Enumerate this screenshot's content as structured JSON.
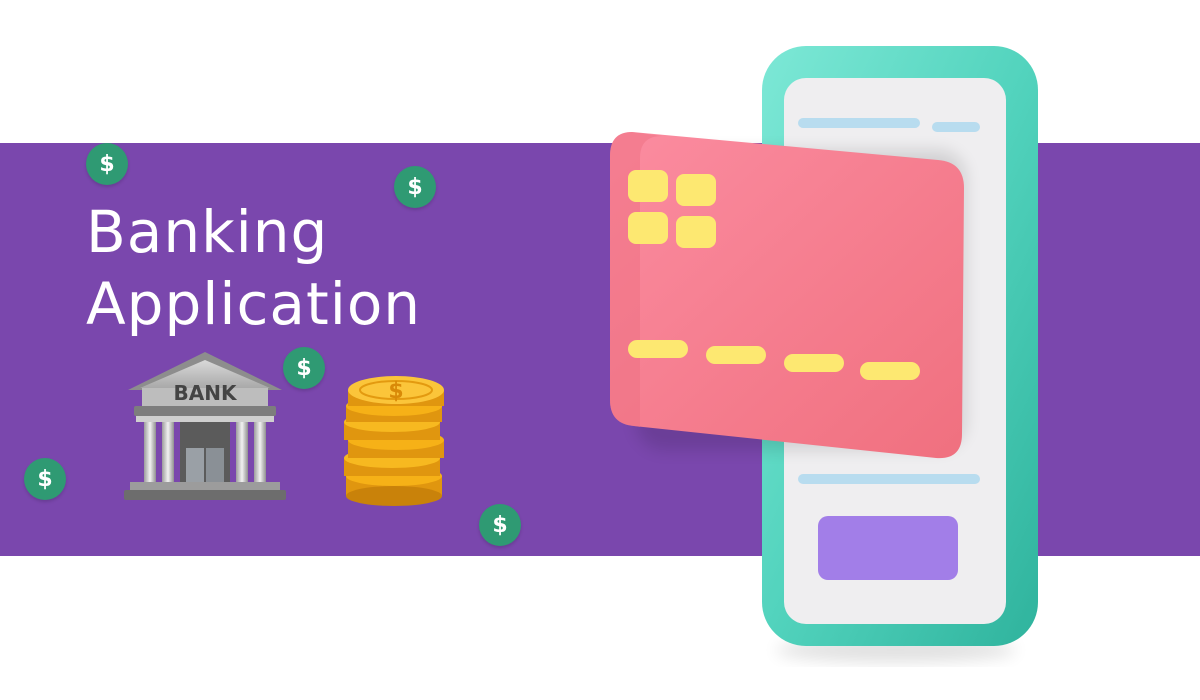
{
  "title": {
    "line1": "Banking",
    "line2": "Application"
  },
  "bank": {
    "sign": "BANK"
  },
  "badges": {
    "symbol": "$"
  },
  "colors": {
    "band": "#7a47ad",
    "badge": "#2f9a73",
    "card": "#f5838f",
    "chip": "#fde871",
    "phone_frame": "#5ad9c5",
    "phone_screen": "#efeef0",
    "phone_button": "#a27ee8",
    "screen_lines": "#b8dcef",
    "coins": "#f6b117"
  },
  "icons": [
    "dollar-badge-icon",
    "bank-building-icon",
    "coin-stack-icon",
    "credit-card-icon",
    "smartphone-icon"
  ]
}
